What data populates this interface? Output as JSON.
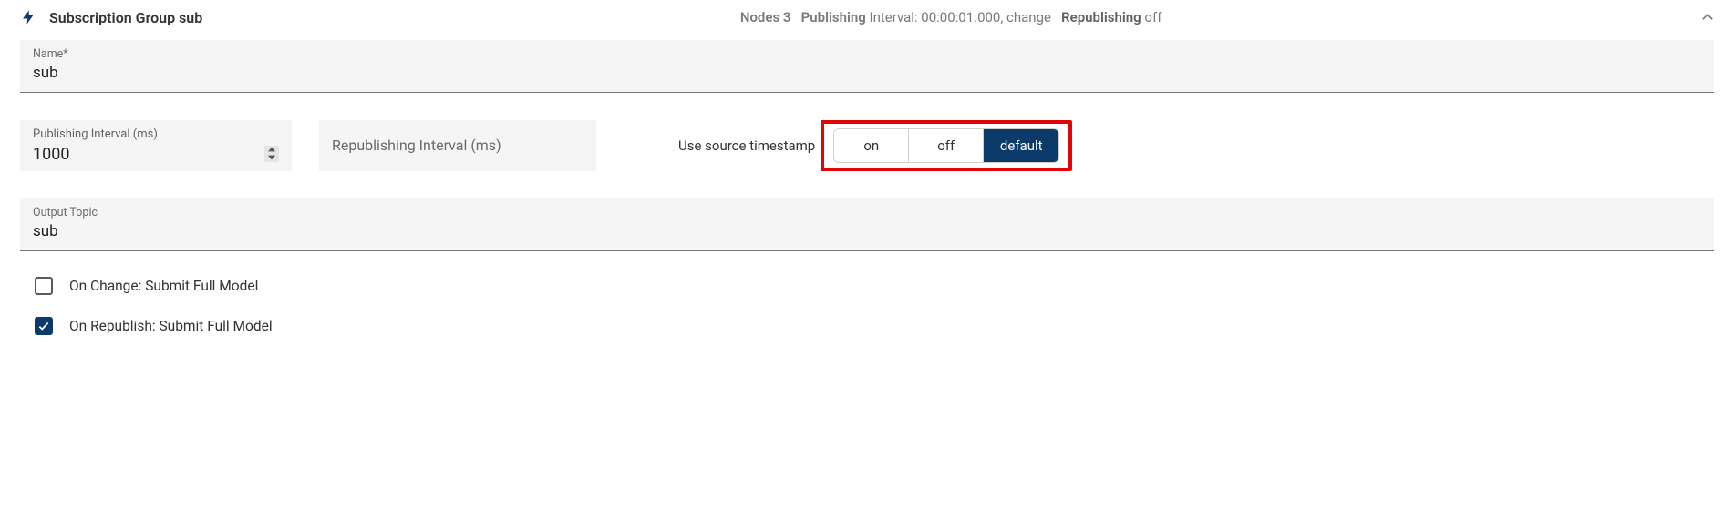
{
  "header": {
    "title": "Subscription Group sub",
    "status": {
      "nodes_label": "Nodes",
      "nodes_count": "3",
      "publishing_label": "Publishing",
      "interval_text": "Interval: 00:00:01.000, change",
      "republishing_label": "Republishing",
      "republishing_value": "off"
    }
  },
  "name_field": {
    "label": "Name*",
    "value": "sub"
  },
  "publishing_interval": {
    "label": "Publishing Interval (ms)",
    "value": "1000"
  },
  "republishing_interval": {
    "placeholder": "Republishing Interval (ms)"
  },
  "timestamp": {
    "label": "Use source timestamp",
    "options": [
      "on",
      "off",
      "default"
    ],
    "selected": "default"
  },
  "output_topic": {
    "label": "Output Topic",
    "value": "sub"
  },
  "checkboxes": {
    "on_change": {
      "label": "On Change: Submit Full Model",
      "checked": false
    },
    "on_republish": {
      "label": "On Republish: Submit Full Model",
      "checked": true
    }
  }
}
